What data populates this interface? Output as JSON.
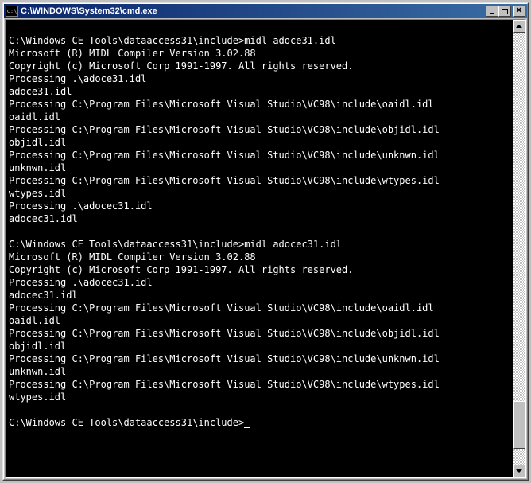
{
  "window": {
    "icon_label": "c:\\",
    "title": "C:\\WINDOWS\\System32\\cmd.exe"
  },
  "console_lines": [
    "",
    "C:\\Windows CE Tools\\dataaccess31\\include>midl adoce31.idl",
    "Microsoft (R) MIDL Compiler Version 3.02.88",
    "Copyright (c) Microsoft Corp 1991-1997. All rights reserved.",
    "Processing .\\adoce31.idl",
    "adoce31.idl",
    "Processing C:\\Program Files\\Microsoft Visual Studio\\VC98\\include\\oaidl.idl",
    "oaidl.idl",
    "Processing C:\\Program Files\\Microsoft Visual Studio\\VC98\\include\\objidl.idl",
    "objidl.idl",
    "Processing C:\\Program Files\\Microsoft Visual Studio\\VC98\\include\\unknwn.idl",
    "unknwn.idl",
    "Processing C:\\Program Files\\Microsoft Visual Studio\\VC98\\include\\wtypes.idl",
    "wtypes.idl",
    "Processing .\\adocec31.idl",
    "adocec31.idl",
    "",
    "C:\\Windows CE Tools\\dataaccess31\\include>midl adocec31.idl",
    "Microsoft (R) MIDL Compiler Version 3.02.88",
    "Copyright (c) Microsoft Corp 1991-1997. All rights reserved.",
    "Processing .\\adocec31.idl",
    "adocec31.idl",
    "Processing C:\\Program Files\\Microsoft Visual Studio\\VC98\\include\\oaidl.idl",
    "oaidl.idl",
    "Processing C:\\Program Files\\Microsoft Visual Studio\\VC98\\include\\objidl.idl",
    "objidl.idl",
    "Processing C:\\Program Files\\Microsoft Visual Studio\\VC98\\include\\unknwn.idl",
    "unknwn.idl",
    "Processing C:\\Program Files\\Microsoft Visual Studio\\VC98\\include\\wtypes.idl",
    "wtypes.idl",
    ""
  ],
  "prompt": "C:\\Windows CE Tools\\dataaccess31\\include>"
}
